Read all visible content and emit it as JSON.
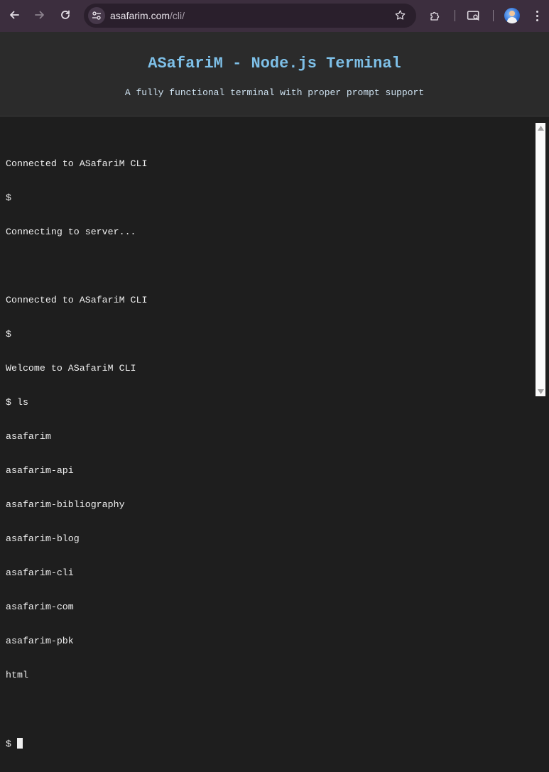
{
  "browser": {
    "url_host": "asafarim.com",
    "url_path": "/cli/",
    "icons": {
      "back": "back-arrow-icon",
      "forward": "forward-arrow-icon",
      "reload": "reload-icon",
      "site_info": "tune-icon",
      "bookmark": "star-icon",
      "extensions": "puzzle-icon",
      "cast": "cast-search-icon",
      "profile": "avatar",
      "menu": "kebab-menu-icon"
    },
    "colors": {
      "toolbar_bg": "#3c2e3e",
      "omnibox_bg": "#2a1f2c"
    }
  },
  "header": {
    "title": "ASafariM - Node.js Terminal",
    "subtitle": "A fully functional terminal with proper prompt support",
    "title_color": "#7ec0e8"
  },
  "terminal": {
    "lines": [
      "Connected to ASafariM CLI",
      "$",
      "Connecting to server...",
      "",
      "Connected to ASafariM CLI",
      "$",
      "Welcome to ASafariM CLI",
      "$ ls",
      "asafarim",
      "asafarim-api",
      "asafarim-bibliography",
      "asafarim-blog",
      "asafarim-cli",
      "asafarim-com",
      "asafarim-pbk",
      "html",
      ""
    ],
    "prompt": "$ ",
    "text_color": "#f0f0f0",
    "background": "#1e1e1e"
  }
}
